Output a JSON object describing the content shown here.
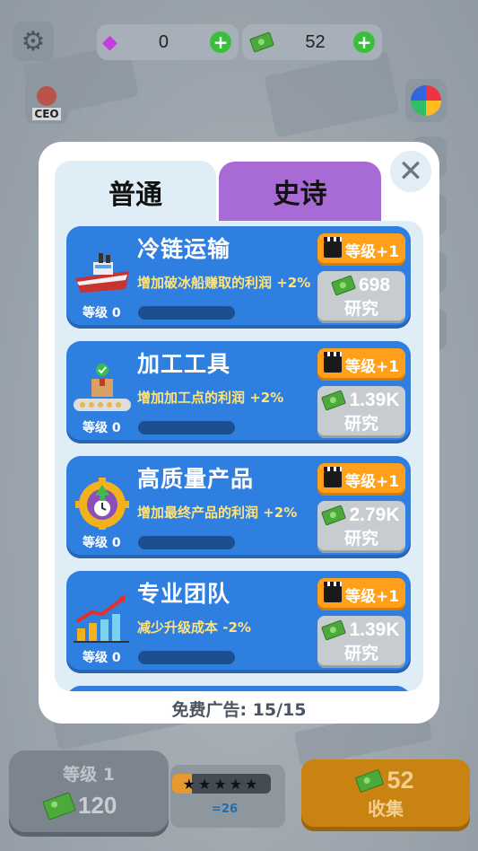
{
  "top": {
    "gems": "0",
    "cash": "52",
    "ceo_label": "CEO"
  },
  "tabs": {
    "normal": "普通",
    "epic": "史诗"
  },
  "close_label": "✕",
  "upgrades": [
    {
      "title": "冷链运输",
      "desc": "增加破冰船赚取的利润 +2%",
      "level": "等级 0",
      "upgrade": "等级+1",
      "cost": "698",
      "research": "研究",
      "icon": "icebreaker-ship-icon"
    },
    {
      "title": "加工工具",
      "desc": "增加加工点的利润 +2%",
      "level": "等级 0",
      "upgrade": "等级+1",
      "cost": "1.39K",
      "research": "研究",
      "icon": "conveyor-box-icon"
    },
    {
      "title": "高质量产品",
      "desc": "增加最终产品的利润 +2%",
      "level": "等级 0",
      "upgrade": "等级+1",
      "cost": "2.79K",
      "research": "研究",
      "icon": "gear-clock-icon"
    },
    {
      "title": "专业团队",
      "desc": "减少升级成本 -2%",
      "level": "等级 0",
      "upgrade": "等级+1",
      "cost": "1.39K",
      "research": "研究",
      "icon": "growth-chart-icon"
    }
  ],
  "free_ads": "免费广告:  15/15",
  "bottom": {
    "level_title": "等级 1",
    "level_cost": "120",
    "stars": "★★★★★",
    "rate": "=26",
    "collect_value": "52",
    "collect_label": "收集"
  },
  "colors": {
    "card": "#2f7fe0",
    "upgrade_btn": "#ff9f1a",
    "epic_tab": "#a86bd6",
    "desc": "#ffe37a"
  }
}
